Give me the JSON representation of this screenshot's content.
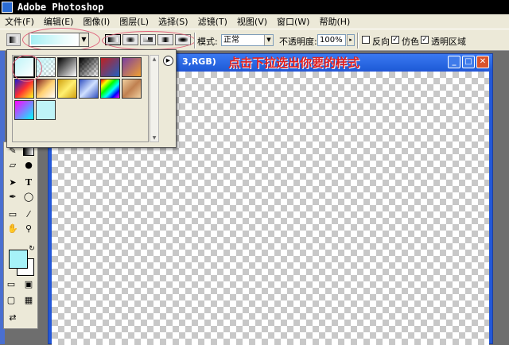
{
  "window": {
    "title": "Adobe Photoshop",
    "app_icon": "photoshop-icon"
  },
  "menubar": {
    "items": [
      "文件(F)",
      "编辑(E)",
      "图像(I)",
      "图层(L)",
      "选择(S)",
      "滤镜(T)",
      "视图(V)",
      "窗口(W)",
      "帮助(H)"
    ]
  },
  "options": {
    "tool_icon": "gradient-tool-icon",
    "mode_label": "模式:",
    "mode_value": "正常",
    "opacity_label": "不透明度:",
    "opacity_value": "100%",
    "reverse_label": "反向",
    "reverse_checked": false,
    "dither_label": "仿色",
    "dither_checked": true,
    "transparency_label": "透明区域",
    "transparency_checked": true,
    "gradient_types": [
      "linear-gradient-icon",
      "radial-gradient-icon",
      "angle-gradient-icon",
      "reflected-gradient-icon",
      "diamond-gradient-icon"
    ],
    "selected_type_index": 0
  },
  "popup": {
    "title": "gradient-presets",
    "menu_icon": "triangle-right-icon",
    "presets": [
      "#bff4f8,#ffffff",
      "#bff4f8,transparent",
      "#000000,#ffffff",
      "#000000,transparent",
      "#c02020,#2060c0",
      "#7a3fa0,#f0a030",
      "#1c1cd0,#ff3030,#ffff20",
      "#802020,#ffd070,#ffffff",
      "#d0a010,#fff070,#d0a010",
      "#3050c0,#d0e0ff,#3050c0",
      "#ff0000,#ffff00,#00ff00,#00ffff,#0000ff,#ff00ff",
      "#f0d0a0,#c08050,#f0d0a0",
      "#ff00ff,#00ffff",
      "#bff4f8,#bff4f8"
    ],
    "selected_index": 0
  },
  "document": {
    "title": "3,RGB)",
    "annotation": "点击下拉选出你要的样式"
  },
  "toolbox": {
    "tools": [
      "brush-icon",
      "gradient-icon",
      "eraser-icon",
      "blur-icon",
      "path-select-icon",
      "text-icon",
      "pen-icon",
      "ellipse-icon",
      "notes-icon",
      "eyedropper-icon",
      "hand-icon",
      "zoom-icon"
    ],
    "foreground_color": "#a6f2f8",
    "background_color": "#ffffff"
  }
}
